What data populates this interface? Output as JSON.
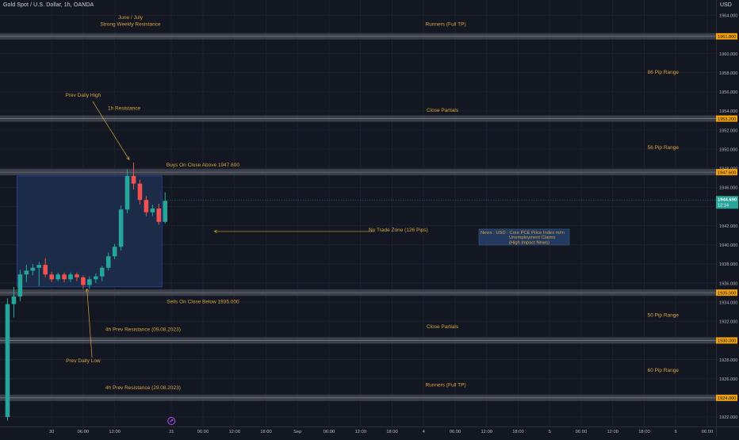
{
  "header": {
    "symbol": "Gold Spot / U.S. Dollar, 1h, OANDA",
    "currency": "USD"
  },
  "theme": {
    "background": "#131722",
    "grid": "#1e222d",
    "text": "#b2b5be",
    "annotation": "#d6a43c",
    "up": "#26a69a",
    "down": "#ef5350",
    "zone_fill": "#1e2f4e",
    "zone_border": "#2962ff",
    "level_band": "#434651",
    "level_tag_bg": "#f2a10a",
    "price_tag_bg": "#26a69a"
  },
  "chart_data": {
    "type": "candlestick",
    "ylim": [
      1921,
      1965.6
    ],
    "y_ticks": [
      1922,
      1924,
      1926,
      1928,
      1930,
      1932,
      1934,
      1936,
      1938,
      1940,
      1942,
      1944,
      1946,
      1948,
      1950,
      1952,
      1954,
      1956,
      1958,
      1960,
      1964
    ],
    "y_tick_labels": [
      "1922.000",
      "1924.000",
      "1926.000",
      "1928.000",
      "1930.000",
      "1932.000",
      "1934.000",
      "1936.000",
      "1938.000",
      "1940.000",
      "1942.000",
      "1944.000",
      "1946.000",
      "1948.000",
      "1950.000",
      "1952.000",
      "1954.000",
      "1956.000",
      "1958.000",
      "1960.000",
      "1964.000"
    ],
    "x_ticks": [
      {
        "label": "30",
        "i": 7
      },
      {
        "label": "06:00",
        "i": 12
      },
      {
        "label": "12:00",
        "i": 17
      },
      {
        "label": "31",
        "i": 26
      },
      {
        "label": "06:00",
        "i": 31
      },
      {
        "label": "12:00",
        "i": 36
      },
      {
        "label": "18:00",
        "i": 41
      },
      {
        "label": "Sep",
        "i": 46
      },
      {
        "label": "06:00",
        "i": 51
      },
      {
        "label": "12:00",
        "i": 56
      },
      {
        "label": "18:00",
        "i": 61
      },
      {
        "label": "4",
        "i": 66
      },
      {
        "label": "06:00",
        "i": 71
      },
      {
        "label": "12:00",
        "i": 76
      },
      {
        "label": "18:00",
        "i": 81
      },
      {
        "label": "5",
        "i": 86
      },
      {
        "label": "06:00",
        "i": 91
      },
      {
        "label": "12:00",
        "i": 96
      },
      {
        "label": "18:00",
        "i": 101
      },
      {
        "label": "6",
        "i": 106
      },
      {
        "label": "06:00",
        "i": 111
      }
    ],
    "candles": [
      [
        1922.0,
        1933.8,
        1921.6,
        1934.4
      ],
      [
        1933.8,
        1934.6,
        1932.4,
        1935.6
      ],
      [
        1934.6,
        1936.9,
        1934.1,
        1937.4
      ],
      [
        1936.9,
        1937.3,
        1936.1,
        1937.9
      ],
      [
        1937.3,
        1937.6,
        1936.8,
        1938.0
      ],
      [
        1937.6,
        1937.9,
        1935.7,
        1938.2
      ],
      [
        1937.9,
        1936.9,
        1936.6,
        1938.6
      ],
      [
        1936.9,
        1936.4,
        1936.1,
        1937.2
      ],
      [
        1936.4,
        1936.9,
        1936.2,
        1937.1
      ],
      [
        1936.9,
        1936.4,
        1936.1,
        1937.1
      ],
      [
        1936.4,
        1936.9,
        1936.1,
        1937.1
      ],
      [
        1936.9,
        1936.6,
        1936.2,
        1937.1
      ],
      [
        1936.6,
        1935.8,
        1935.4,
        1936.8
      ],
      [
        1935.8,
        1936.4,
        1935.4,
        1936.7
      ],
      [
        1936.4,
        1936.7,
        1936.0,
        1937.0
      ],
      [
        1936.7,
        1937.6,
        1936.2,
        1937.8
      ],
      [
        1937.6,
        1938.8,
        1937.3,
        1939.2
      ],
      [
        1938.8,
        1939.8,
        1938.5,
        1940.1
      ],
      [
        1939.8,
        1943.7,
        1939.4,
        1944.1
      ],
      [
        1943.7,
        1947.2,
        1943.3,
        1947.9
      ],
      [
        1947.2,
        1946.4,
        1945.8,
        1948.6
      ],
      [
        1946.4,
        1944.7,
        1944.2,
        1946.8
      ],
      [
        1944.7,
        1943.4,
        1943.0,
        1945.1
      ],
      [
        1943.4,
        1943.8,
        1943.0,
        1944.2
      ],
      [
        1943.8,
        1942.4,
        1942.1,
        1944.3
      ],
      [
        1942.4,
        1944.6,
        1942.2,
        1945.5
      ]
    ],
    "current_price": {
      "value": 1944.69,
      "label": "1944.690",
      "countdown": "12:14"
    },
    "levels": [
      {
        "price": 1961.8,
        "tag": "1961.800"
      },
      {
        "price": 1953.2,
        "tag": "1953.200"
      },
      {
        "price": 1947.6,
        "tag": "1947.600"
      },
      {
        "price": 1935.0,
        "tag": "1935.000"
      },
      {
        "price": 1930.0,
        "tag": "1930.000"
      },
      {
        "price": 1924.0,
        "tag": "1924.000"
      }
    ],
    "zone": {
      "label": "No Trade Zone (126 Pips)",
      "from_i": 1.5,
      "to_i": 24.5,
      "low": 1935.6,
      "high": 1947.2
    },
    "annotations": [
      {
        "text": "June / July",
        "i": 19.5,
        "price": 1963.6
      },
      {
        "text": "Strong Weekly Resistance",
        "i": 19.5,
        "price": 1962.9
      },
      {
        "text": "Runners (Full TP)",
        "i": 69.5,
        "price": 1962.9
      },
      {
        "text": "86 Pip Range",
        "i": 104,
        "price": 1957.9
      },
      {
        "text": "Prev Daily High",
        "i": 12,
        "price": 1955.5
      },
      {
        "text": "1h Resistance",
        "i": 18.5,
        "price": 1954.1
      },
      {
        "text": "Close Partials",
        "i": 69,
        "price": 1953.9
      },
      {
        "text": "56 Pip Range",
        "i": 104,
        "price": 1950.0
      },
      {
        "text": "Buys On Close Above 1947.600",
        "i": 31,
        "price": 1948.2
      },
      {
        "text": "No Trade Zone (126 Pips)",
        "i": 62,
        "price": 1941.4
      },
      {
        "text": "Sells On Close Below 1935.000",
        "i": 31,
        "price": 1933.9
      },
      {
        "text": "4h Prev Resistance (09.08.2023)",
        "i": 21.5,
        "price": 1931.0
      },
      {
        "text": "Close Partials",
        "i": 69,
        "price": 1931.3
      },
      {
        "text": "50 Pip Range",
        "i": 104,
        "price": 1932.5
      },
      {
        "text": "Prev Daily Low",
        "i": 12,
        "price": 1927.7
      },
      {
        "text": "60 Pip Range",
        "i": 104,
        "price": 1926.7
      },
      {
        "text": "4h Prev Resistance (29.08.2023)",
        "i": 21.5,
        "price": 1924.9
      },
      {
        "text": "Runners (Full TP)",
        "i": 69.5,
        "price": 1925.2
      }
    ],
    "news_box": {
      "lines": [
        "News : USD : Core PCE Price Index m/m",
        "Unemployment Claims",
        "(High Impact News)"
      ]
    },
    "arrows": [
      {
        "from_i": 13.5,
        "from_price": 1955.0,
        "to_i": 19.3,
        "to_price": 1948.9
      },
      {
        "from_i": 13.4,
        "from_price": 1928.2,
        "to_i": 12.6,
        "to_price": 1935.4
      },
      {
        "from_i": 58.2,
        "from_price": 1941.4,
        "to_i": 32.8,
        "to_price": 1941.4
      }
    ]
  }
}
